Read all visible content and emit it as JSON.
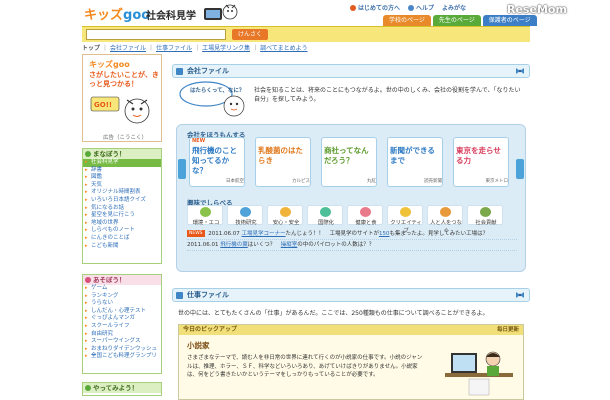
{
  "header": {
    "logo": "キッズ",
    "logo_goo": "goo",
    "site_title": "社会科見学",
    "links": [
      "はじめての方へ",
      "ヘルプ",
      "よみがな"
    ],
    "watermark": "ReseMom",
    "tabs": [
      "学校のページ",
      "先生のページ",
      "保護者のページ"
    ]
  },
  "search": {
    "button": "けんさく",
    "value": ""
  },
  "breadcrumb": [
    "トップ",
    "会社ファイル",
    "仕事ファイル",
    "工場見学リンク集",
    "調べてまとめよう"
  ],
  "ad": {
    "title": "キッズgoo",
    "text": "さがしたいことが、きっと見つかる！",
    "go": "GO!!",
    "label": "広告（こうこく）"
  },
  "sidebar": {
    "manabou": {
      "title": "まなぼう！",
      "items": [
        "社会科見学",
        "辞書",
        "図鑑",
        "天気",
        "オリジナル時間割表",
        "いろいろ日本語クイズ",
        "気になるお話",
        "星空を見に行こう",
        "地域の世界",
        "しらべものノート",
        "にんきのことば",
        "こども新聞"
      ]
    },
    "asobou": {
      "title": "あそぼう！",
      "items": [
        "ゲーム",
        "ランキング",
        "うらない",
        "しんだん・心理テスト",
        "ぐっぴよんマンガ",
        "スクールライフ",
        "自由研究",
        "スーパーウイングス",
        "おまねりダイデンウッシュー",
        "全国こども料理グランプリ"
      ]
    },
    "yattemiyou": {
      "title": "やってみよう！"
    }
  },
  "company_file": {
    "title": "会社ファイル",
    "speech": "はたらくって、なに？",
    "intro": "社会を知ることは、将来のことにもつながるよ。世の中のしくみ、会社の役割を学んで、「なりたい自分」を探してみよう。",
    "carousel_title": "会社をほうもんする",
    "new_label": "NEW",
    "cards": [
      {
        "title": "飛行機のこと知ってるかな？",
        "brand": "日本航空",
        "color": "#2e7bc4"
      },
      {
        "title": "乳酸菌のはたらき",
        "brand": "カルピス",
        "color": "#e07a1f"
      },
      {
        "title": "商社ってなんだろう？",
        "brand": "丸紅",
        "color": "#5a9a2a"
      },
      {
        "title": "新聞ができるまで",
        "brand": "読売新聞",
        "color": "#2e7bc4"
      },
      {
        "title": "東京を走らせる力",
        "brand": "東京メトロ",
        "color": "#d83a5a"
      }
    ],
    "categories_title": "興味でしらべる",
    "categories": [
      {
        "label": "環境・エコ",
        "color": "#8bc34a"
      },
      {
        "label": "技術研究",
        "color": "#4fa3d9"
      },
      {
        "label": "安心・安全",
        "color": "#f0b43a"
      },
      {
        "label": "国際化",
        "color": "#4fbf9a"
      },
      {
        "label": "健康と食",
        "color": "#e87a8a"
      },
      {
        "label": "クリエイティブ",
        "color": "#f0c23a"
      },
      {
        "label": "人と人をつなぐ",
        "color": "#e89a3a"
      },
      {
        "label": "社会貢献",
        "color": "#7aa84a"
      }
    ],
    "news": [
      {
        "badge": "NEWS",
        "date": "2011.06.07",
        "link": "工場見学コーナー",
        "text1": "たんじょう！！　工場見学のサイトが",
        "link2": "150",
        "text2": "も集まったよ。見学してみたい工場は？"
      },
      {
        "badge": "",
        "date": "2011.06.01",
        "link": "飛行機の翼",
        "text1": "はいくつ？　",
        "link2": "操縦室",
        "text2": "の中のパイロットの人数は？？"
      }
    ]
  },
  "job_file": {
    "title": "仕事ファイル",
    "intro": "世の中には、とてもたくさんの「仕事」があるんだ。ここでは、250種類もの仕事について調べることができるよ。",
    "pickup_title": "今日のピックアップ",
    "pickup_date": "毎日更新",
    "job_title": "小説家",
    "job_desc": "さまざまなテーマで、読む人を非日常の世界に連れて行くのが小説家の仕事です。小説のジャンルは、推理、ホラー、ＳＦ、科学などいろいろあり、あげていけばきりがありません。小説家は、何をどう書きたいかというテーマをしっかりもっていることが必要です。"
  }
}
